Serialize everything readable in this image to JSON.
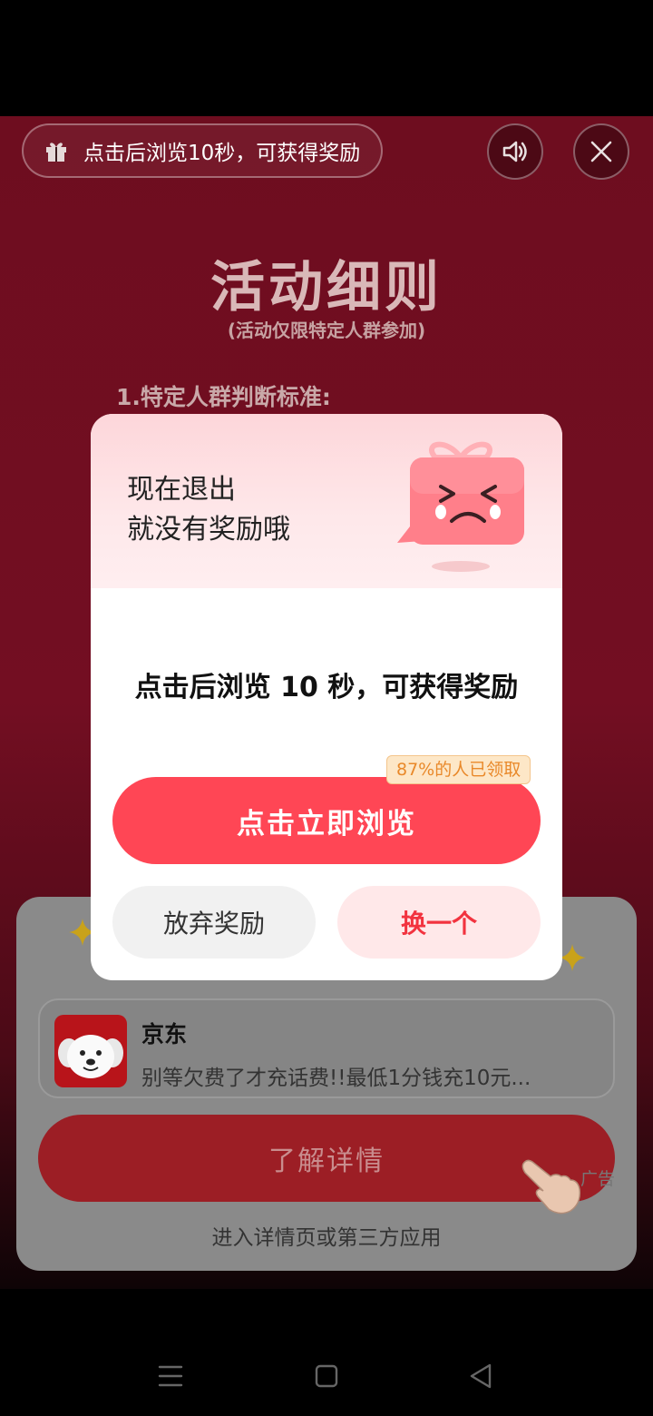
{
  "ad": {
    "notice_text": "点击后浏览10秒，可获得奖励",
    "rules_title": "活动细则",
    "rules_subtitle": "(活动仅限特定人群参加)",
    "rules_item_1": "1.特定人群判断标准:",
    "app_name": "京东",
    "app_desc": "别等欠费了才充话费!!最低1分钱充10元...",
    "detail_button": "了解详情",
    "detail_hint": "进入详情页或第三方应用",
    "ad_label": "广告"
  },
  "modal": {
    "head_line1": "现在退出",
    "head_line2": "就没有奖励哦",
    "message": "点击后浏览 10 秒，可获得奖励",
    "badge": "87%的人已领取",
    "primary_button": "点击立即浏览",
    "give_up_button": "放弃奖励",
    "switch_button": "换一个"
  },
  "icons": {
    "notice": "gift-icon",
    "sound": "speaker-icon",
    "close": "close-icon",
    "nav_menu": "menu-icon",
    "nav_home": "home-icon",
    "nav_back": "back-icon"
  },
  "colors": {
    "primary": "#ff4655",
    "switch_text": "#f2333f",
    "badge_text": "#e9892a"
  }
}
